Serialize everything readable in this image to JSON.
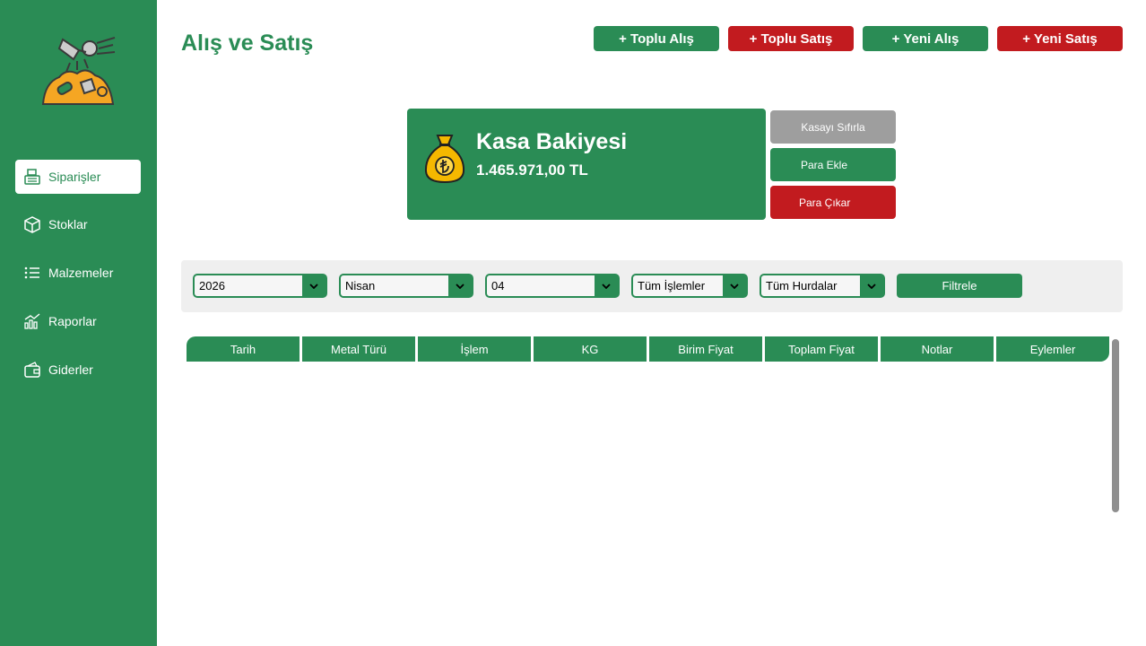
{
  "page": {
    "title": "Alış ve Satış"
  },
  "sidebar": {
    "items": [
      {
        "label": "Siparişler",
        "icon": "register-icon",
        "active": true
      },
      {
        "label": "Stoklar",
        "icon": "box-icon"
      },
      {
        "label": "Malzemeler",
        "icon": "list-icon"
      },
      {
        "label": "Raporlar",
        "icon": "chart-icon"
      },
      {
        "label": "Giderler",
        "icon": "wallet-icon"
      }
    ]
  },
  "header": {
    "buttons": [
      {
        "label": "+ Toplu Alış",
        "color": "#2a8c55"
      },
      {
        "label": "+ Toplu Satış",
        "color": "#c21b1f"
      },
      {
        "label": "+ Yeni Alış",
        "color": "#2a8c55"
      },
      {
        "label": "+ Yeni Satış",
        "color": "#c21b1f"
      }
    ]
  },
  "balance": {
    "title": "Kasa Bakiyesi",
    "value": "1.465.971,00 TL",
    "icon": "money-bag-icon",
    "actions": [
      {
        "label": "Kasayı Sıfırla",
        "color": "#9e9e9e"
      },
      {
        "label": "Para Ekle",
        "color": "#2a8c55"
      },
      {
        "label": "Para Çıkar",
        "color": "#c21b1f"
      }
    ]
  },
  "filters": {
    "year": "2026",
    "month": "Nisan",
    "day": "04",
    "operation": "Tüm İşlemler",
    "scrap": "Tüm Hurdalar",
    "button": "Filtrele"
  },
  "table": {
    "columns": [
      "Tarih",
      "Metal Türü",
      "İşlem",
      "KG",
      "Birim Fiyat",
      "Toplam Fiyat",
      "Notlar",
      "Eylemler"
    ],
    "rows": []
  },
  "colors": {
    "primary": "#2a8c55",
    "danger": "#c21b1f",
    "muted": "#9e9e9e"
  }
}
